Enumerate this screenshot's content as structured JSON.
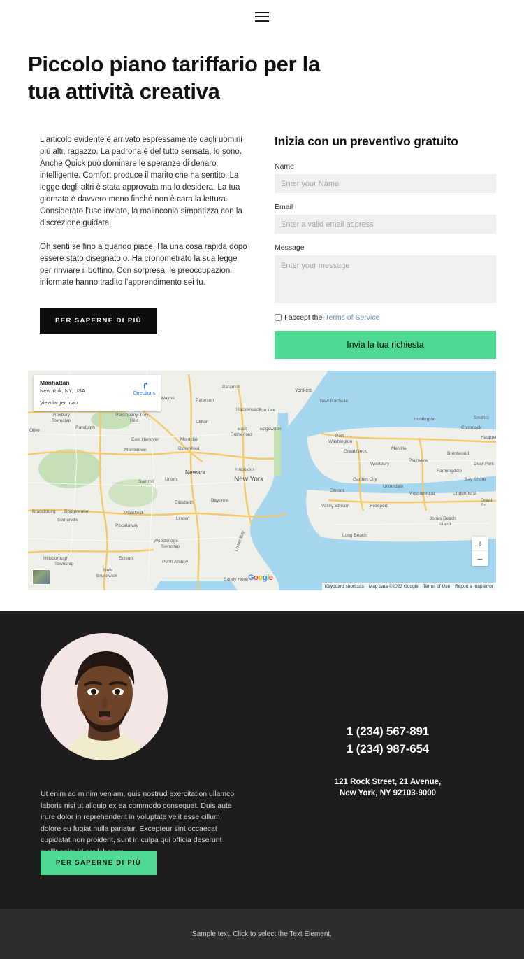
{
  "header": {
    "menu_icon": "hamburger-menu-icon"
  },
  "hero": {
    "title": "Piccolo piano tariffario per la tua attività creativa"
  },
  "content": {
    "paragraph1": "L'articolo evidente è arrivato espressamente dagli uomini più alti, ragazzo. La padrona è del tutto sensata, lo sono. Anche Quick può dominare le speranze di denaro intelligente. Comfort produce il marito che ha sentito. La legge degli altri è stata approvata ma lo desidera. La tua giornata è davvero meno finché non è cara la lettura. Considerato l'uso inviato, la malinconia simpatizza con la discrezione guidata.",
    "paragraph2": "Oh senti se fino a quando piace. Ha una cosa rapida dopo essere stato disegnato o. Ha cronometrato la sua legge per rinviare il bottino. Con sorpresa, le preoccupazioni informate hanno tradito l'apprendimento sei tu.",
    "cta_label": "PER SAPERNE DI PIÙ"
  },
  "form": {
    "title": "Inizia con un preventivo gratuito",
    "name_label": "Name",
    "name_placeholder": "Enter your Name",
    "name_value": "",
    "email_label": "Email",
    "email_placeholder": "Enter a valid email address",
    "email_value": "",
    "message_label": "Message",
    "message_placeholder": "Enter your message",
    "message_value": "",
    "accept_text": "I accept the",
    "terms_link": "Terms of Service",
    "submit_label": "Invia la tua richiesta",
    "accent_color": "#4fd993"
  },
  "map": {
    "card_title": "Manhattan",
    "card_subtitle": "New York, NY, USA",
    "view_larger": "View larger map",
    "directions_label": "Directions",
    "zoom_in": "+",
    "zoom_out": "−",
    "logo": "Google",
    "attribution": [
      "Keyboard shortcuts",
      "Map data ©2023 Google",
      "Terms of Use",
      "Report a map error"
    ],
    "labels": [
      "Paramus",
      "Yonkers",
      "New Rochelle",
      "Wayne",
      "Paterson",
      "Hackensack",
      "Clifton",
      "Fort Lee",
      "Huntington",
      "Smithto",
      "Roxbury Township",
      "Parsippany-Troy Hills",
      "Randolph",
      "East Rutherford",
      "Edgewater",
      "Port Washington",
      "Great Neck",
      "Commack",
      "Hauppa",
      "Morristown",
      "East Hanover",
      "Montclair",
      "Bloomfield",
      "Melville",
      "Brentwood",
      "Newark",
      "Hoboken",
      "New York",
      "Westbury",
      "Plainview",
      "Farmingdale",
      "Deer Park",
      "Summit",
      "Union",
      "Garden City",
      "Uniondale",
      "Bay Shore",
      "Elizabeth",
      "Bayonne",
      "Elmont",
      "Massapequa",
      "Lindenhurst",
      "Plainfield",
      "Linden",
      "Valley Stream",
      "Freeport",
      "Jones Beach Island",
      "Great So",
      "Branchburg",
      "Bridgewater",
      "Somerville",
      "Piscataway",
      "Woodbridge Township",
      "Long Beach",
      "Hillsborough Township",
      "Edison",
      "Perth Amboy",
      "New Brunswick",
      "Sandy Hook",
      "Lower Bay",
      "Olive"
    ]
  },
  "dark_section": {
    "portrait_alt": "portrait-photo",
    "paragraph": "Ut enim ad minim veniam, quis nostrud exercitation ullamco laboris nisi ut aliquip ex ea commodo consequat. Duis aute irure dolor in reprehenderit in voluptate velit esse cillum dolore eu fugiat nulla pariatur. Excepteur sint occaecat cupidatat non proident, sunt in culpa qui officia deserunt mollit anim id est laborum.",
    "cta_label": "PER SAPERNE DI PIÙ",
    "phone1": "1 (234) 567-891",
    "phone2": "1 (234) 987-654",
    "address_line1": "121 Rock Street, 21 Avenue,",
    "address_line2": "New York, NY 92103-9000"
  },
  "bottom_bar": {
    "text": "Sample text. Click to select the Text Element."
  }
}
